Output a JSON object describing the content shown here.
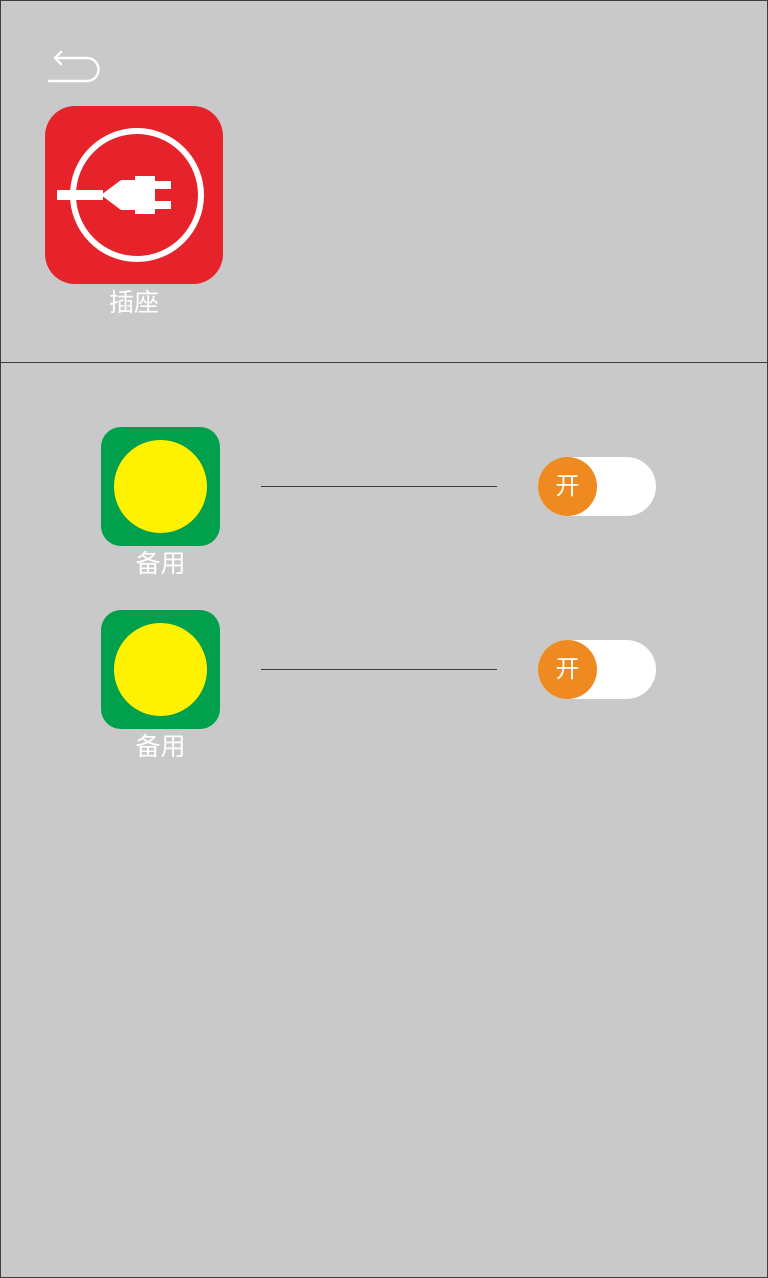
{
  "colors": {
    "background": "#c8c9c8",
    "border": "#3d3d3d",
    "device_tile": "#e6222b",
    "outlet_tile": "#00a04c",
    "outlet_lamp": "#fff200",
    "toggle_track": "#ffffff",
    "toggle_knob": "#ef8a21",
    "label_text": "#ffffff"
  },
  "header": {
    "back_icon": "back-arrow-icon",
    "device": {
      "icon": "power-plug-icon",
      "label": "插座"
    }
  },
  "outlets": [
    {
      "icon": "lamp-indicator-icon",
      "label": "备用",
      "switch_label": "开",
      "switch_on": true
    },
    {
      "icon": "lamp-indicator-icon",
      "label": "备用",
      "switch_label": "开",
      "switch_on": true
    }
  ]
}
